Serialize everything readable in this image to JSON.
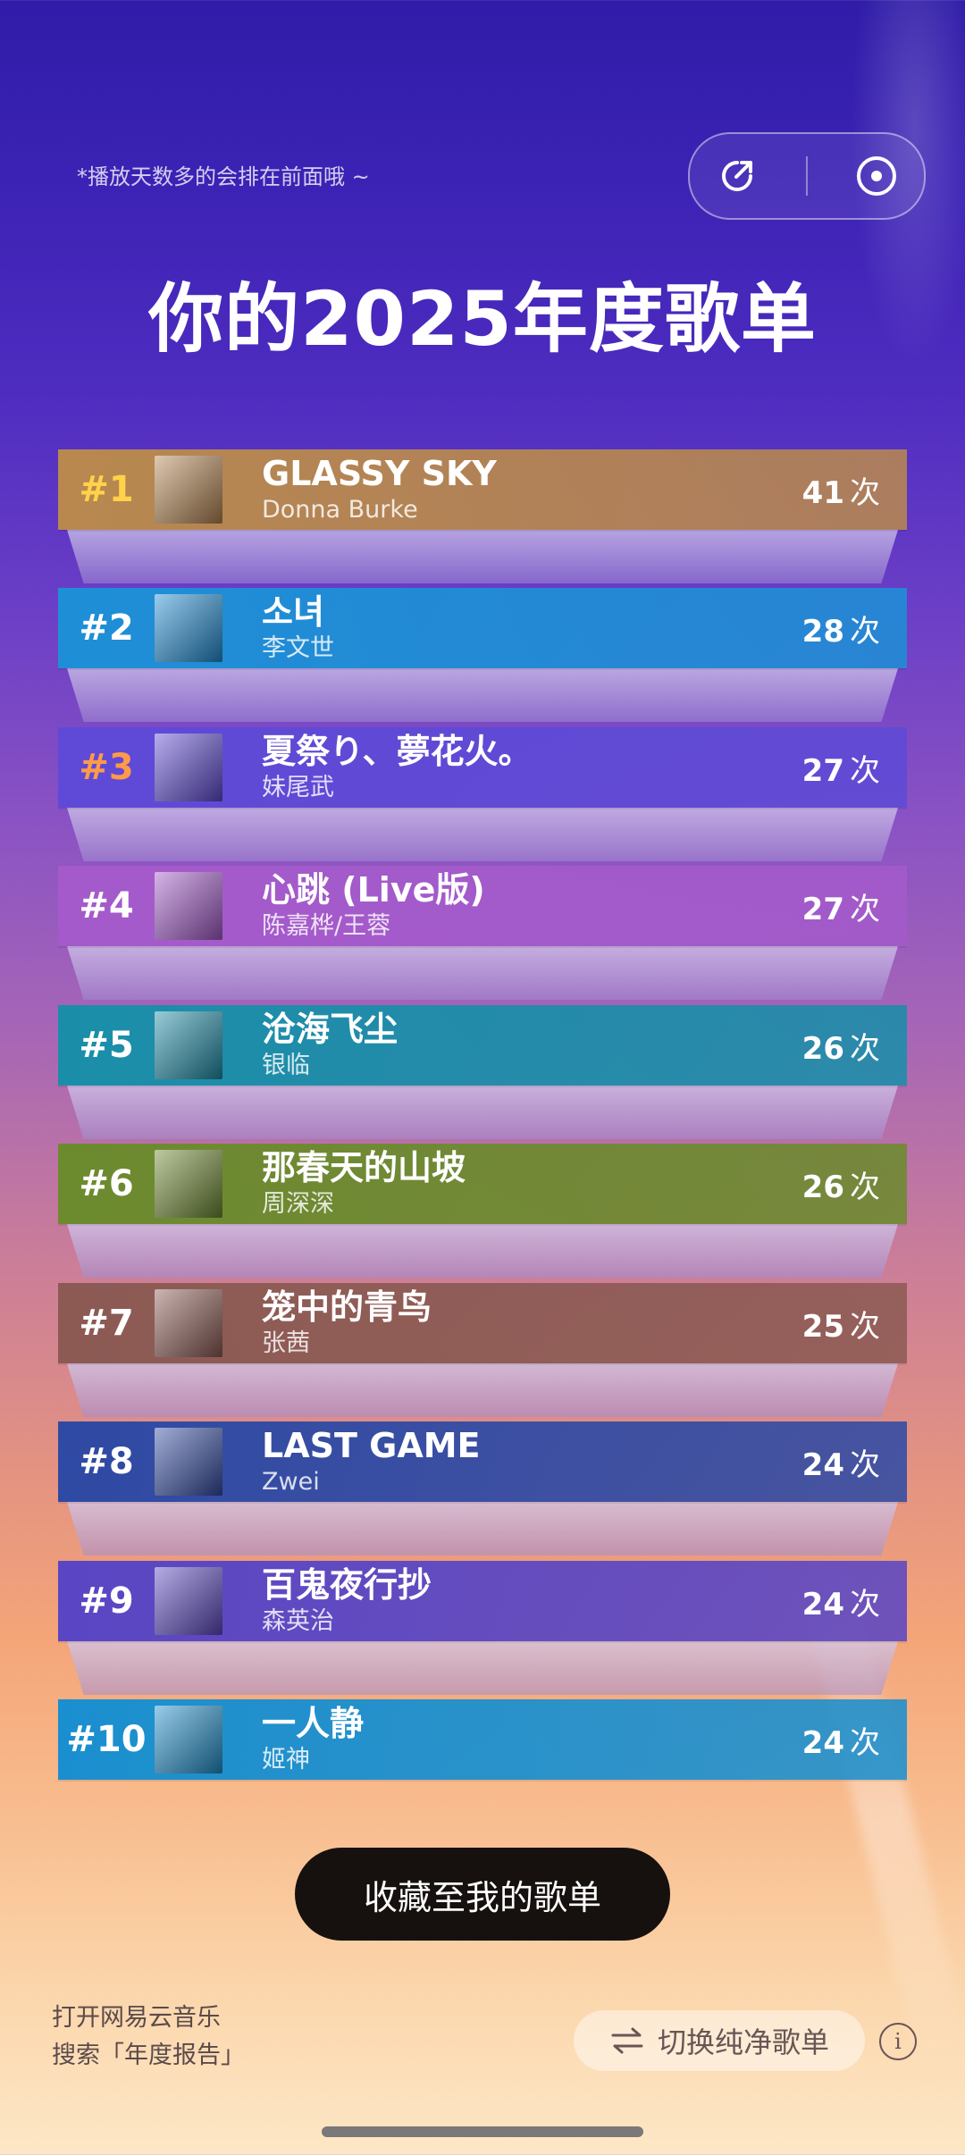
{
  "hint": "*播放天数多的会排在前面哦 ~",
  "title": "你的2025年度歌单",
  "icons": {
    "share": "share-icon",
    "record": "record-icon",
    "switch": "swap-icon",
    "info": "info-icon"
  },
  "unit": "次",
  "songs": [
    {
      "rank": "#1",
      "title": "GLASSY SKY",
      "artist": "Donna Burke",
      "count": "41",
      "color": "#b8884f",
      "rank_color": "#ffd24a"
    },
    {
      "rank": "#2",
      "title": "소녀",
      "artist": "李文世",
      "count": "28",
      "color": "#1e8fd6",
      "rank_color": "#ffffff"
    },
    {
      "rank": "#3",
      "title": "夏祭り、夢花火。",
      "artist": "妹尾武",
      "count": "27",
      "color": "#5e4ad6",
      "rank_color": "#ff9a4a"
    },
    {
      "rank": "#4",
      "title": "心跳 (Live版)",
      "artist": "陈嘉桦/王蓉",
      "count": "27",
      "color": "#a45acb",
      "rank_color": "#ffffff"
    },
    {
      "rank": "#5",
      "title": "沧海飞尘",
      "artist": "银临",
      "count": "26",
      "color": "#1a8ea9",
      "rank_color": "#ffffff"
    },
    {
      "rank": "#6",
      "title": "那春天的山坡",
      "artist": "周深深",
      "count": "26",
      "color": "#6c8a2e",
      "rank_color": "#ffffff"
    },
    {
      "rank": "#7",
      "title": "笼中的青鸟",
      "artist": "张茜",
      "count": "25",
      "color": "#8c5a53",
      "rank_color": "#ffffff"
    },
    {
      "rank": "#8",
      "title": "LAST GAME",
      "artist": "Zwei",
      "count": "24",
      "color": "#2f4aa4",
      "rank_color": "#ffffff"
    },
    {
      "rank": "#9",
      "title": "百鬼夜行抄",
      "artist": "森英治",
      "count": "24",
      "color": "#5a46c4",
      "rank_color": "#ffffff"
    },
    {
      "rank": "#10",
      "title": "一人静",
      "artist": "姬神",
      "count": "24",
      "color": "#1a8fcf",
      "rank_color": "#ffffff"
    }
  ],
  "collect_button": "收藏至我的歌单",
  "footer": {
    "line1": "打开网易云音乐",
    "line2": "搜索「年度报告」"
  },
  "switch_button": "切换纯净歌单",
  "info_label": "i"
}
